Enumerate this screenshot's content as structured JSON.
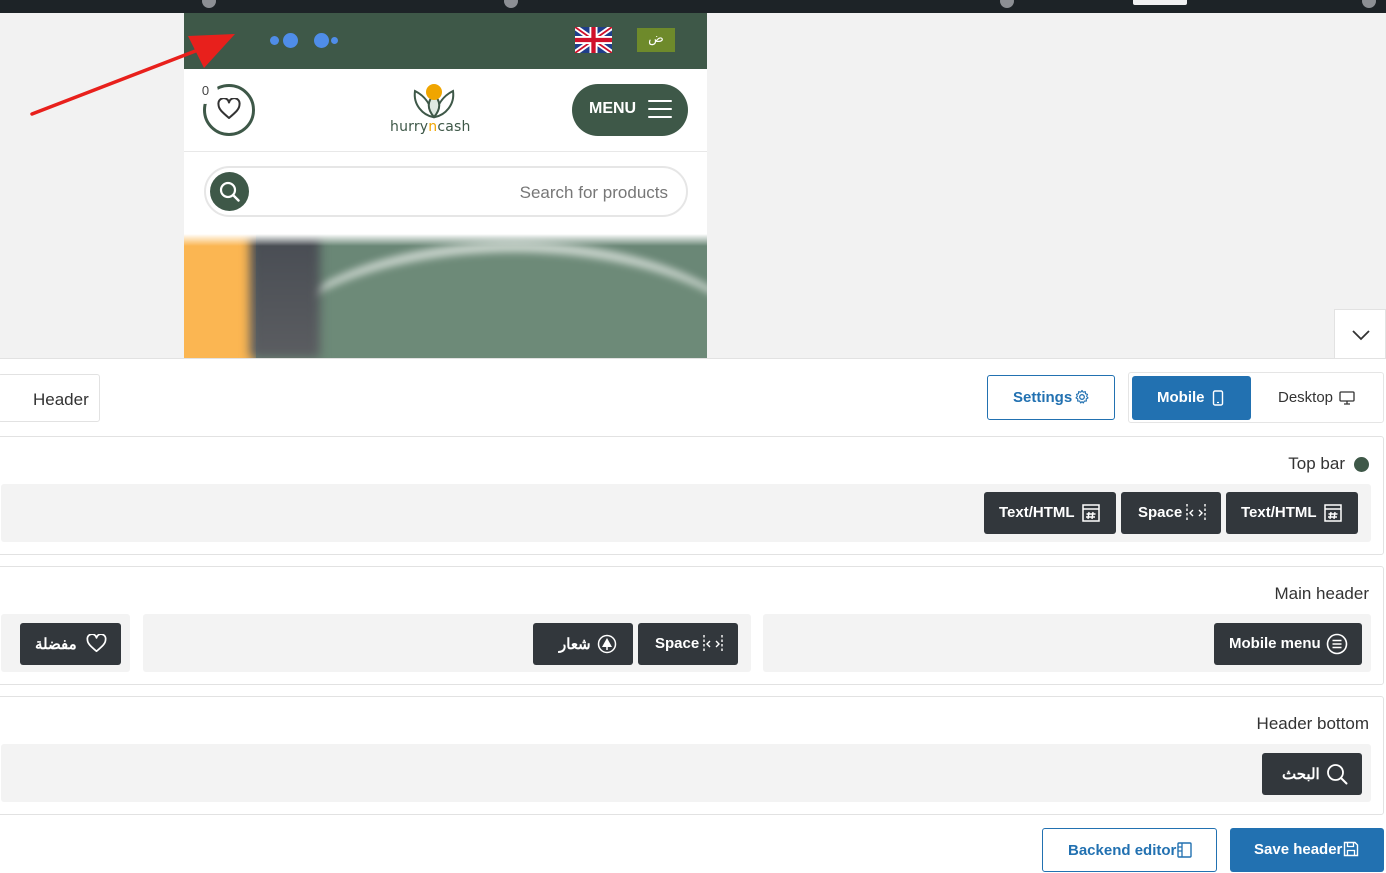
{
  "preview": {
    "wishlist_count": "0",
    "logo": {
      "part1": "hurry",
      "part2": "n",
      "part3": "cash"
    },
    "menu_label": "MENU",
    "search_placeholder": "Search for products",
    "arabic_badge": "ض"
  },
  "builder": {
    "header_tab_label": "Header",
    "settings_label": "Settings",
    "devices": {
      "mobile_label": "Mobile",
      "desktop_label": "Desktop"
    },
    "rows": {
      "top_bar": {
        "title": "Top bar",
        "elements": [
          "Text/HTML",
          "Space",
          "Text/HTML"
        ]
      },
      "main_header": {
        "title": "Main header",
        "wishlist_label": "مفضلة",
        "logo_label": "شعار",
        "space_label": "Space",
        "mobile_menu_label": "Mobile menu"
      },
      "header_bottom": {
        "title": "Header bottom",
        "search_label": "البحث"
      }
    },
    "footer": {
      "backend_label": "Backend editor",
      "save_label": "Save header"
    }
  },
  "colors": {
    "brand_green": "#3e5848",
    "wp_blue": "#2271b1",
    "chip_dark": "#32373c",
    "arrow_red": "#e8201c"
  }
}
